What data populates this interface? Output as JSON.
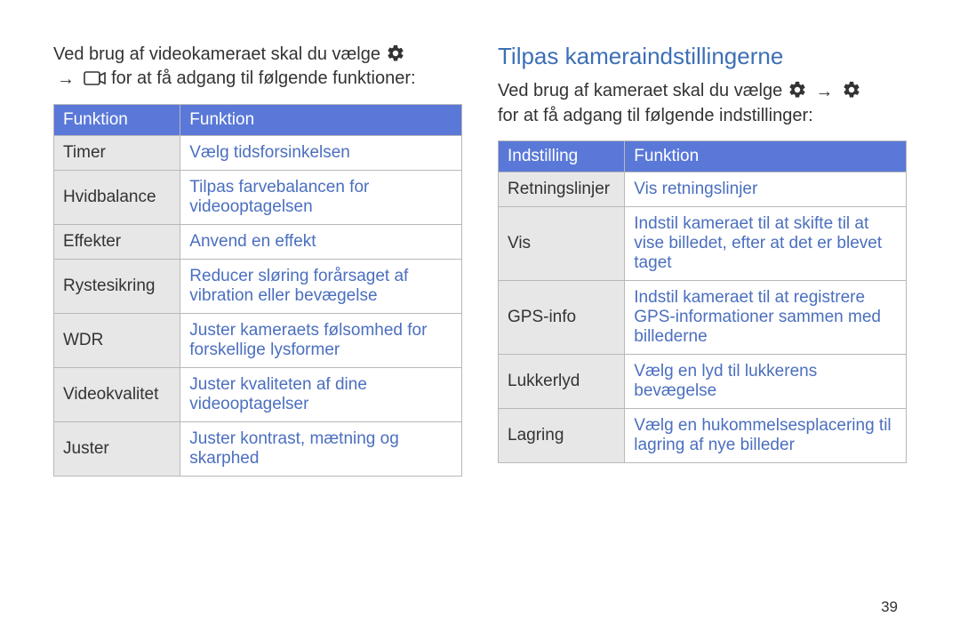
{
  "pageNumber": "39",
  "left": {
    "intro_a": "Ved brug af videokameraet skal du vælge ",
    "intro_b": " for at få adgang til følgende funktioner:",
    "arrow": "→",
    "headers": {
      "c1": "Funktion",
      "c2": "Funktion"
    },
    "rows": [
      {
        "l": "Timer",
        "r": "Vælg tidsforsinkelsen"
      },
      {
        "l": "Hvidbalance",
        "r": "Tilpas farvebalancen for videooptagelsen"
      },
      {
        "l": "Effekter",
        "r": "Anvend en effekt"
      },
      {
        "l": "Rystesikring",
        "r": "Reducer sløring forårsaget af vibration eller bevægelse"
      },
      {
        "l": "WDR",
        "r": "Juster kameraets følsomhed for forskellige lysformer"
      },
      {
        "l": "Videokvalitet",
        "r": "Juster kvaliteten af dine videooptagelser"
      },
      {
        "l": "Juster",
        "r": "Juster kontrast, mætning og skarphed"
      }
    ]
  },
  "right": {
    "title": "Tilpas kameraindstillingerne",
    "intro_a": "Ved brug af kameraet skal du vælge ",
    "intro_b": " for at få adgang til følgende indstillinger:",
    "arrow": "→",
    "headers": {
      "c1": "Indstilling",
      "c2": "Funktion"
    },
    "rows": [
      {
        "l": "Retningslinjer",
        "r": "Vis retningslinjer"
      },
      {
        "l": "Vis",
        "r": "Indstil kameraet til at skifte til at vise billedet, efter at det er blevet taget"
      },
      {
        "l": "GPS-info",
        "r": "Indstil kameraet til at registrere GPS-informationer sammen med billederne"
      },
      {
        "l": "Lukkerlyd",
        "r": "Vælg en lyd til lukkerens bevægelse"
      },
      {
        "l": "Lagring",
        "r": "Vælg en hukommelsesplacering til lagring af nye billeder"
      }
    ]
  }
}
